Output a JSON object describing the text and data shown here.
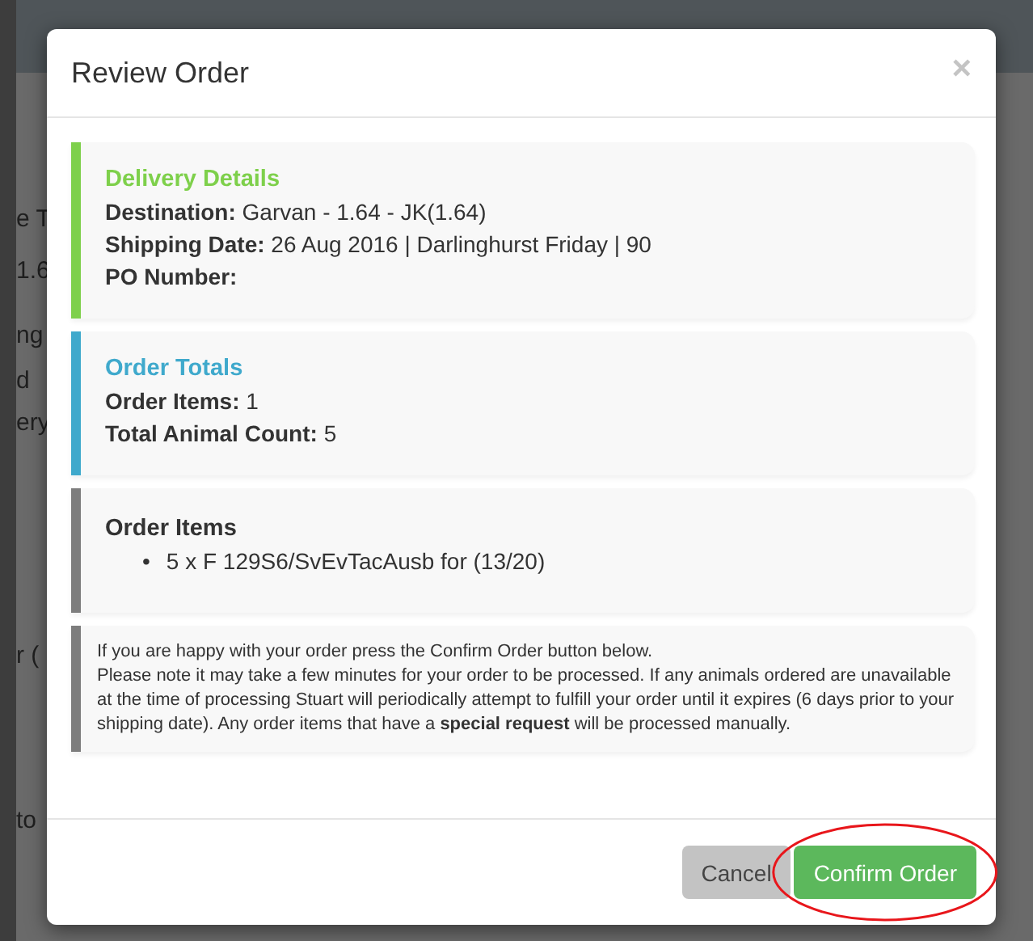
{
  "background_page": {
    "fragments": [
      "e T",
      "1.6",
      "ng",
      "d",
      "ery",
      "r (",
      "to"
    ]
  },
  "modal": {
    "title": "Review Order",
    "close": "×",
    "panels": [
      {
        "kind": "details",
        "color": "#7ed04b",
        "heading": "Delivery Details",
        "lines": [
          {
            "label": "Destination:",
            "value": "Garvan - 1.64 - JK(1.64)"
          },
          {
            "label": "Shipping Date:",
            "value": "26 Aug 2016 | Darlinghurst Friday | 90"
          },
          {
            "label": "PO Number:"
          }
        ]
      },
      {
        "kind": "details",
        "color": "#3fa9cc",
        "heading": "Order Totals",
        "lines": [
          {
            "label": "Order Items:",
            "value": "1"
          },
          {
            "label": "Total Animal Count:",
            "value": "5"
          }
        ]
      },
      {
        "kind": "list",
        "color": "#7d7d7d",
        "heading": "Order Items",
        "marker": "•",
        "items": [
          "5 x F 129S6/SvEvTacAusb for (13/20)"
        ]
      },
      {
        "kind": "note",
        "color": "#7d7d7d",
        "paragraphs": [
          "If you are happy with your order press the Confirm Order button below.",
          "Please note it may take a few minutes for your order to be processed. If any animals ordered are unavailable at the time of processing Stuart will periodically attempt to fulfill your order until it expires (6 days prior to your shipping date). Any order items that have a **special request** will be processed manually."
        ]
      }
    ],
    "buttons": [
      {
        "kind": "secondary",
        "label": "Cancel"
      },
      {
        "kind": "primary",
        "label": "Confirm Order",
        "highlighted": true
      }
    ]
  }
}
